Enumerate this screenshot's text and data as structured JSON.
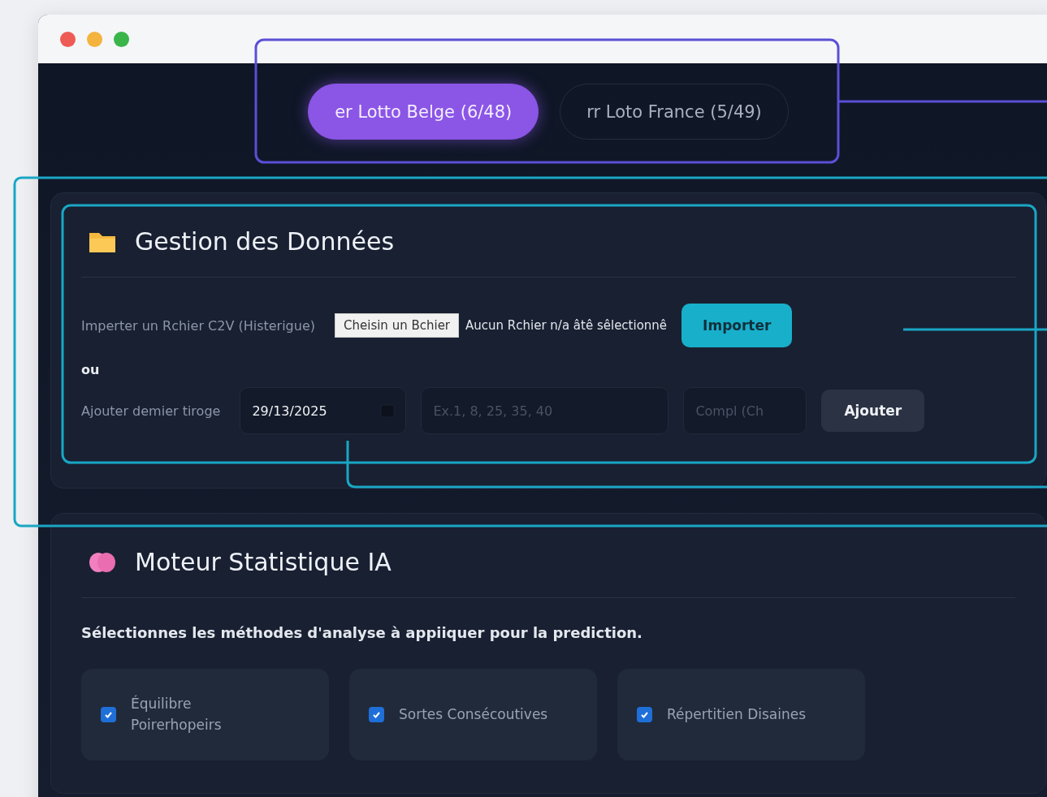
{
  "tabs": [
    {
      "flag": "er",
      "label": "Lotto Belge (6/48)",
      "selected": true
    },
    {
      "flag": "rr",
      "label": "Loto France (5/49)",
      "selected": false
    }
  ],
  "data_section": {
    "title": "Gestion des Données",
    "import": {
      "label": "Imperter un Rchier C2V (Histerigue)",
      "file_button": "Cheisin un Bchier",
      "file_status": "Aucun Rchier n/a âtê sêlectionnê",
      "button": "Importer"
    },
    "separator": "ou",
    "add": {
      "label": "Ajouter demier tiroge",
      "date": "29/13/2025",
      "numbers_placeholder": "Ex.1, 8, 25, 35, 40",
      "compl_placeholder": "Compl (Ch",
      "button": "Ajouter"
    }
  },
  "engine_section": {
    "title": "Moteur Statistique IA",
    "description": "Sélectionnes les méthodes d'analyse à appiiquer pour la prediction.",
    "methods": [
      {
        "label": "Équilibre Poirerhopeirs",
        "checked": true
      },
      {
        "label": "Sortes Consécoutives",
        "checked": true
      },
      {
        "label": "Répertitien Disaines",
        "checked": true
      }
    ]
  }
}
